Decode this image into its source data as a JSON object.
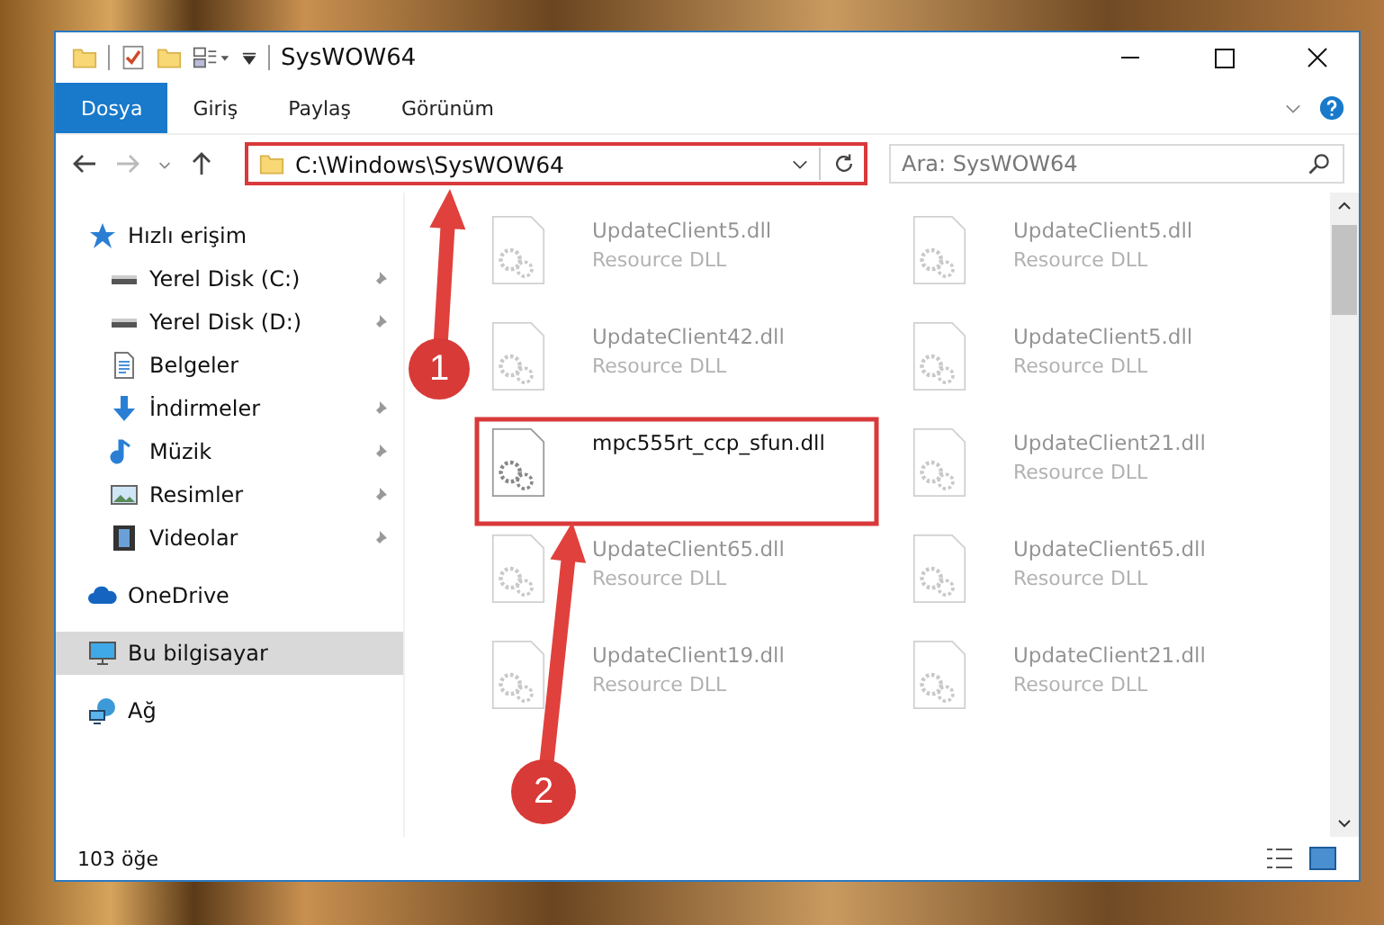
{
  "window": {
    "title": "SysWOW64"
  },
  "ribbon_tabs": [
    {
      "label": "Dosya",
      "selected": true
    },
    {
      "label": "Giriş",
      "selected": false
    },
    {
      "label": "Paylaş",
      "selected": false
    },
    {
      "label": "Görünüm",
      "selected": false
    }
  ],
  "address_bar": {
    "path": "C:\\Windows\\SysWOW64"
  },
  "search": {
    "placeholder": "Ara: SysWOW64"
  },
  "sidebar": {
    "items": [
      {
        "label": "Hızlı erişim",
        "kind": "star",
        "selected": false,
        "children": [
          {
            "label": "Yerel Disk (C:)",
            "kind": "drive",
            "pinned": true,
            "selected": false
          },
          {
            "label": "Yerel Disk (D:)",
            "kind": "drive",
            "pinned": true,
            "selected": false
          },
          {
            "label": "Belgeler",
            "kind": "document",
            "pinned": false,
            "selected": false
          },
          {
            "label": "İndirmeler",
            "kind": "download",
            "pinned": true,
            "selected": false
          },
          {
            "label": "Müzik",
            "kind": "music",
            "pinned": true,
            "selected": false
          },
          {
            "label": "Resimler",
            "kind": "picture",
            "pinned": true,
            "selected": false
          },
          {
            "label": "Videolar",
            "kind": "video",
            "pinned": true,
            "selected": false
          }
        ]
      },
      {
        "label": "OneDrive",
        "kind": "cloud",
        "selected": false
      },
      {
        "label": "Bu bilgisayar",
        "kind": "computer",
        "selected": true
      },
      {
        "label": "Ağ",
        "kind": "network",
        "selected": false
      }
    ]
  },
  "files": [
    {
      "name": "UpdateClient5.dll",
      "type": "Resource DLL",
      "faded": true
    },
    {
      "name": "UpdateClient5.dll",
      "type": "Resource DLL",
      "faded": true
    },
    {
      "name": "UpdateClient42.dll",
      "type": "Resource DLL",
      "faded": true
    },
    {
      "name": "UpdateClient5.dll",
      "type": "Resource DLL",
      "faded": true
    },
    {
      "name": "mpc555rt_ccp_sfun.dll",
      "faded": false
    },
    {
      "name": "UpdateClient21.dll",
      "type": "Resource DLL",
      "faded": true
    },
    {
      "name": "UpdateClient65.dll",
      "type": "Resource DLL",
      "faded": true
    },
    {
      "name": "UpdateClient65.dll",
      "type": "Resource DLL",
      "faded": true
    },
    {
      "name": "UpdateClient19.dll",
      "type": "Resource DLL",
      "faded": true
    },
    {
      "name": "UpdateClient21.dll",
      "type": "Resource DLL",
      "faded": true
    }
  ],
  "status_bar": {
    "count": "103 öğe"
  },
  "annotations": [
    {
      "label": "1"
    },
    {
      "label": "2"
    }
  ]
}
